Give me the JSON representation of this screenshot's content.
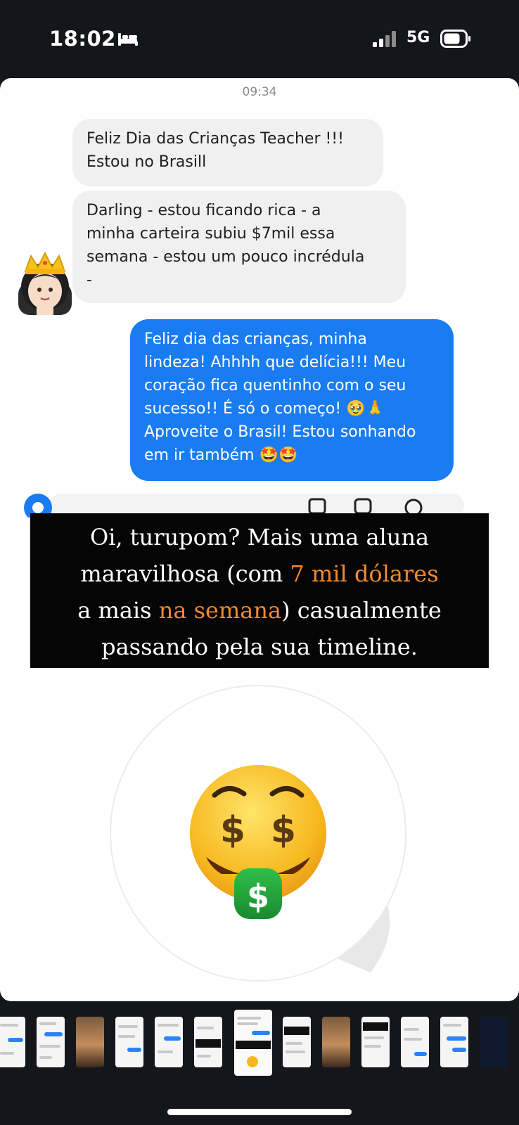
{
  "status_bar": {
    "time": "18:02",
    "network": "5G",
    "icons": [
      "bed-icon",
      "signal-icon",
      "battery-icon"
    ]
  },
  "chat": {
    "timestamp": "09:34",
    "messages": [
      {
        "sender": "other",
        "text": "Feliz Dia das Crianças Teacher !!!\nEstou no Brasill"
      },
      {
        "sender": "other",
        "text": "Darling - estou ficando rica - a\nminha carteira subiu $7mil essa\nsemana - estou um pouco incrédula\n-"
      },
      {
        "sender": "me",
        "text_parts": [
          "Feliz dia das crianças, minha\nlindeza! Ahhhh que delícia!!! Meu\ncoração fica quentinho com o seu\nsucesso!! É só o começo! ",
          "🥹🙏",
          "\nAproveite o Brasil! Estou sonhando\nem ir também ",
          "🤩🤩"
        ]
      }
    ],
    "avatar_icon": "princess-emoji-icon"
  },
  "caption": {
    "parts": [
      "Oi, turupom? Mais uma aluna\nmaravilhosa (com ",
      "7 mil dólares",
      "\na mais ",
      "na semana",
      ") casualmente\npassando pela sua timeline."
    ],
    "highlight_color": "#f08a2e"
  },
  "sticker": {
    "icon": "money-mouth-face-icon",
    "glyph": "$"
  },
  "thumbnail_strip": {
    "count": 13,
    "active_index": 6
  },
  "colors": {
    "outgoing_bubble": "#1a7cf2",
    "incoming_bubble": "#f0f0f0",
    "caption_bg": "#050505"
  }
}
